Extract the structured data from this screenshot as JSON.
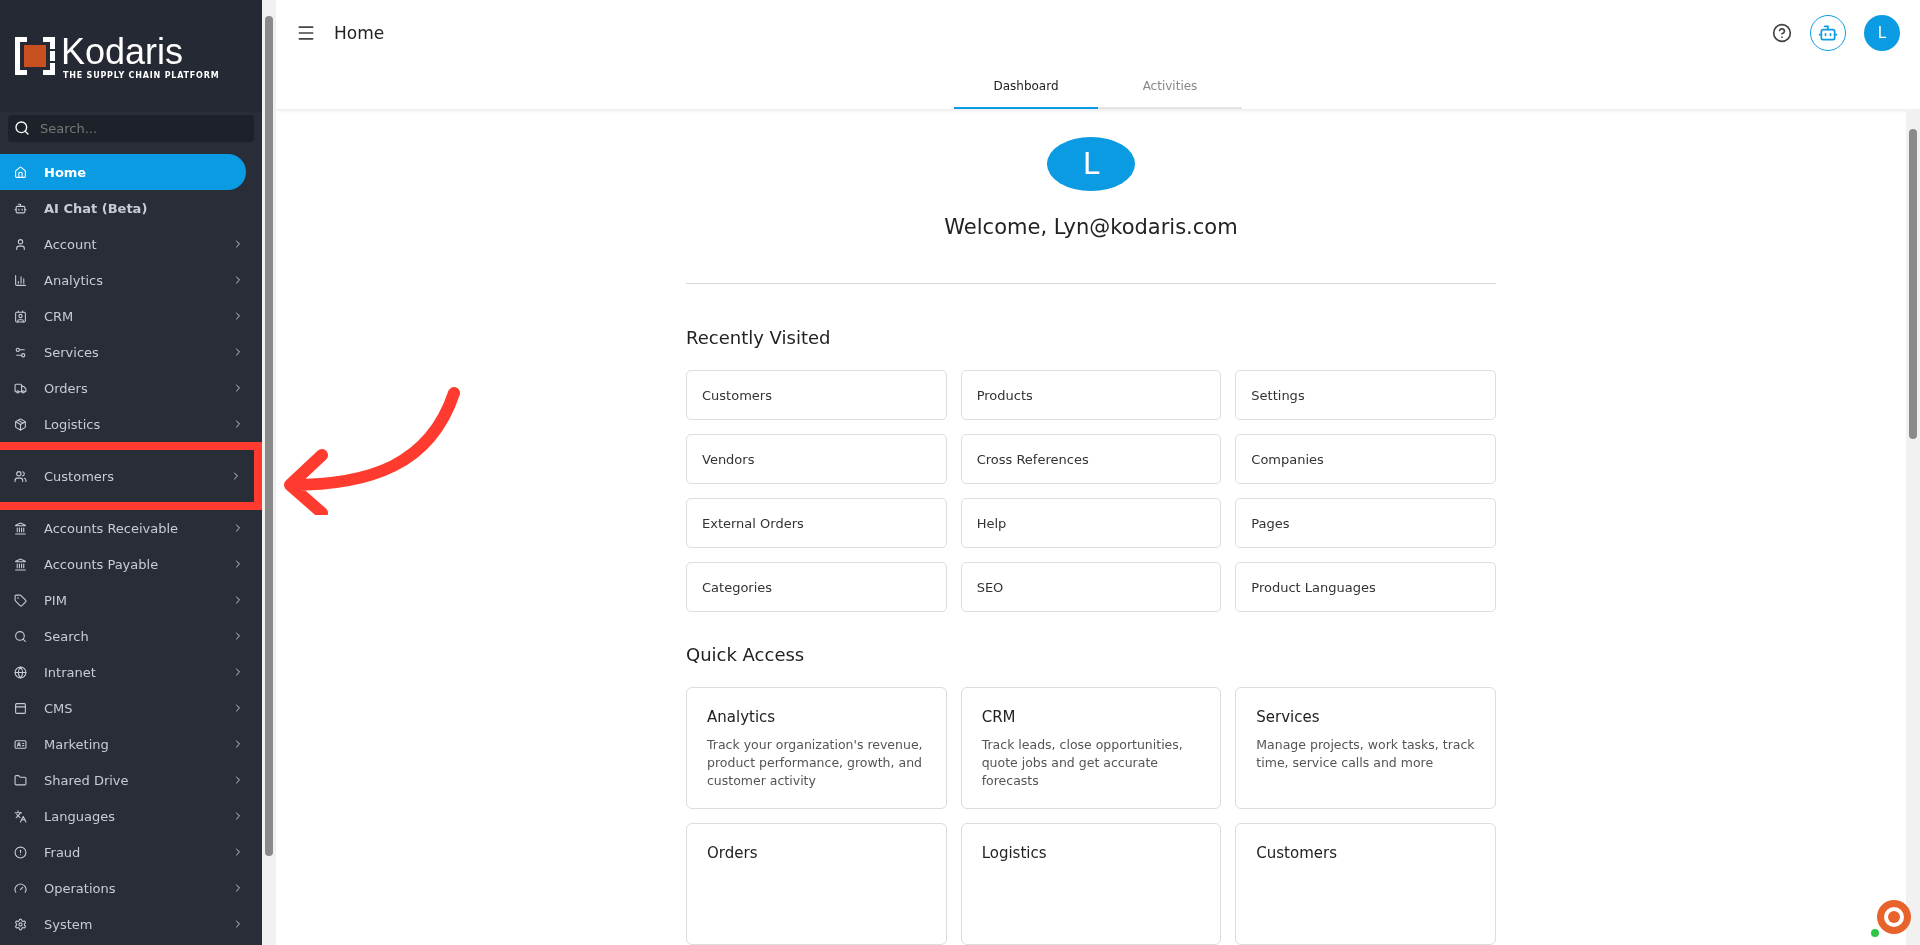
{
  "sidebar": {
    "logo": {
      "name": "Kodaris",
      "tagline": "THE SUPPLY CHAIN PLATFORM"
    },
    "search": {
      "placeholder": "Search..."
    },
    "items": [
      {
        "label": "Home",
        "selected": true,
        "kind": "plain",
        "highlighted": false
      },
      {
        "label": "AI Chat (Beta)",
        "selected": false,
        "kind": "plain",
        "highlighted": false
      },
      {
        "label": "Account",
        "selected": false,
        "kind": "group",
        "highlighted": false
      },
      {
        "label": "Analytics",
        "selected": false,
        "kind": "group",
        "highlighted": false
      },
      {
        "label": "CRM",
        "selected": false,
        "kind": "group",
        "highlighted": false
      },
      {
        "label": "Services",
        "selected": false,
        "kind": "group",
        "highlighted": false
      },
      {
        "label": "Orders",
        "selected": false,
        "kind": "group",
        "highlighted": false
      },
      {
        "label": "Logistics",
        "selected": false,
        "kind": "group",
        "highlighted": false
      },
      {
        "label": "Customers",
        "selected": false,
        "kind": "group",
        "highlighted": true
      },
      {
        "label": "Accounts Receivable",
        "selected": false,
        "kind": "group",
        "highlighted": false
      },
      {
        "label": "Accounts Payable",
        "selected": false,
        "kind": "group",
        "highlighted": false
      },
      {
        "label": "PIM",
        "selected": false,
        "kind": "group",
        "highlighted": false
      },
      {
        "label": "Search",
        "selected": false,
        "kind": "group",
        "highlighted": false
      },
      {
        "label": "Intranet",
        "selected": false,
        "kind": "group",
        "highlighted": false
      },
      {
        "label": "CMS",
        "selected": false,
        "kind": "group",
        "highlighted": false
      },
      {
        "label": "Marketing",
        "selected": false,
        "kind": "group",
        "highlighted": false
      },
      {
        "label": "Shared Drive",
        "selected": false,
        "kind": "group",
        "highlighted": false
      },
      {
        "label": "Languages",
        "selected": false,
        "kind": "group",
        "highlighted": false
      },
      {
        "label": "Fraud",
        "selected": false,
        "kind": "group",
        "highlighted": false
      },
      {
        "label": "Operations",
        "selected": false,
        "kind": "group",
        "highlighted": false
      },
      {
        "label": "System",
        "selected": false,
        "kind": "group",
        "highlighted": false
      }
    ]
  },
  "header": {
    "title": "Home",
    "avatar": "L"
  },
  "tabs": [
    {
      "label": "Dashboard",
      "selected": true
    },
    {
      "label": "Activities",
      "selected": false
    }
  ],
  "welcome": {
    "avatar": "L",
    "text": "Welcome, Lyn@kodaris.com"
  },
  "recently_visited": {
    "title": "Recently Visited",
    "items": [
      "Customers",
      "Products",
      "Settings",
      "Vendors",
      "Cross References",
      "Companies",
      "External Orders",
      "Help",
      "Pages",
      "Categories",
      "SEO",
      "Product Languages"
    ]
  },
  "quick_access": {
    "title": "Quick Access",
    "cards": [
      {
        "title": "Analytics",
        "description": "Track your organization's revenue, product performance, growth, and customer activity"
      },
      {
        "title": "CRM",
        "description": "Track leads, close opportunities, quote jobs and get accurate forecasts"
      },
      {
        "title": "Services",
        "description": "Manage projects, work tasks, track time, service calls and more"
      },
      {
        "title": "Orders"
      },
      {
        "title": "Logistics"
      },
      {
        "title": "Customers"
      }
    ]
  }
}
